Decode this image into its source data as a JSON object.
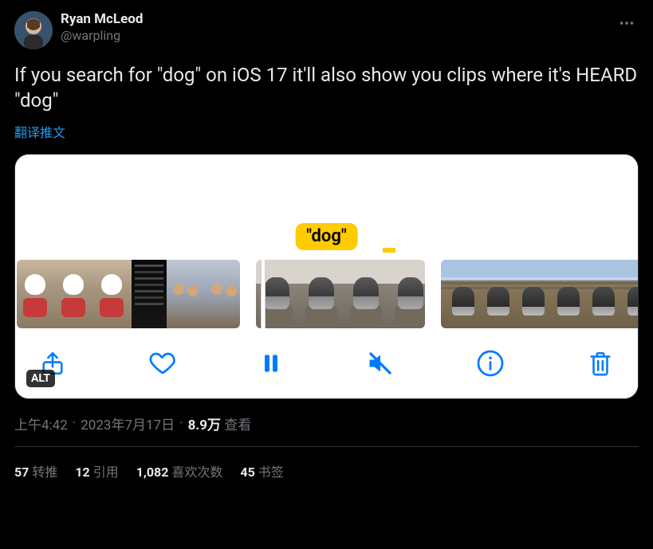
{
  "author": {
    "name": "Ryan McLeod",
    "handle": "@warpling"
  },
  "body_text": "If you search for \"dog\" on iOS 17 it'll also show you clips where it's HEARD \"dog\"",
  "translate_label": "翻译推文",
  "media": {
    "tag_label": "\"dog\"",
    "alt_badge": "ALT"
  },
  "meta": {
    "time": "上午4:42",
    "date": "2023年7月17日",
    "views_value": "8.9万",
    "views_label": "查看"
  },
  "stats": {
    "retweets_value": "57",
    "retweets_label": "转推",
    "quotes_value": "12",
    "quotes_label": "引用",
    "likes_value": "1,082",
    "likes_label": "喜欢次数",
    "bookmarks_value": "45",
    "bookmarks_label": "书签"
  }
}
